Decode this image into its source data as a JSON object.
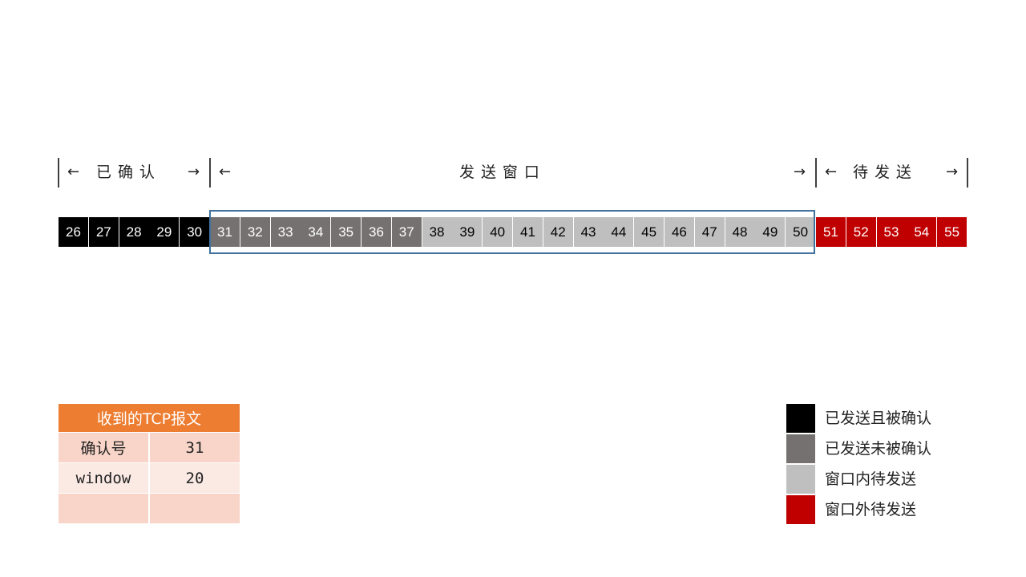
{
  "header": {
    "acked_label": "已 确 认",
    "window_label": "发 送 窗 口",
    "pending_label": "待 发 送",
    "left_arrow": "←",
    "right_arrow": "→"
  },
  "sequence": {
    "acked": [
      "26",
      "27",
      "28",
      "29",
      "30"
    ],
    "sent_unacked": [
      "31",
      "32",
      "33",
      "34",
      "35",
      "36",
      "37"
    ],
    "in_window_pending": [
      "38",
      "39",
      "40",
      "41",
      "42",
      "43",
      "44",
      "45",
      "46",
      "47",
      "48",
      "49",
      "50"
    ],
    "outside_window": [
      "51",
      "52",
      "53",
      "54",
      "55"
    ]
  },
  "tcp_table": {
    "title": "收到的TCP报文",
    "rows": [
      {
        "key": "确认号",
        "value": "31"
      },
      {
        "key": "window",
        "value": "20"
      },
      {
        "key": "",
        "value": ""
      }
    ]
  },
  "legend": [
    {
      "label": "已发送且被确认",
      "color": "#000000"
    },
    {
      "label": "已发送未被确认",
      "color": "#767171"
    },
    {
      "label": "窗口内待发送",
      "color": "#bfbfbf"
    },
    {
      "label": "窗口外待发送",
      "color": "#c00000"
    }
  ]
}
